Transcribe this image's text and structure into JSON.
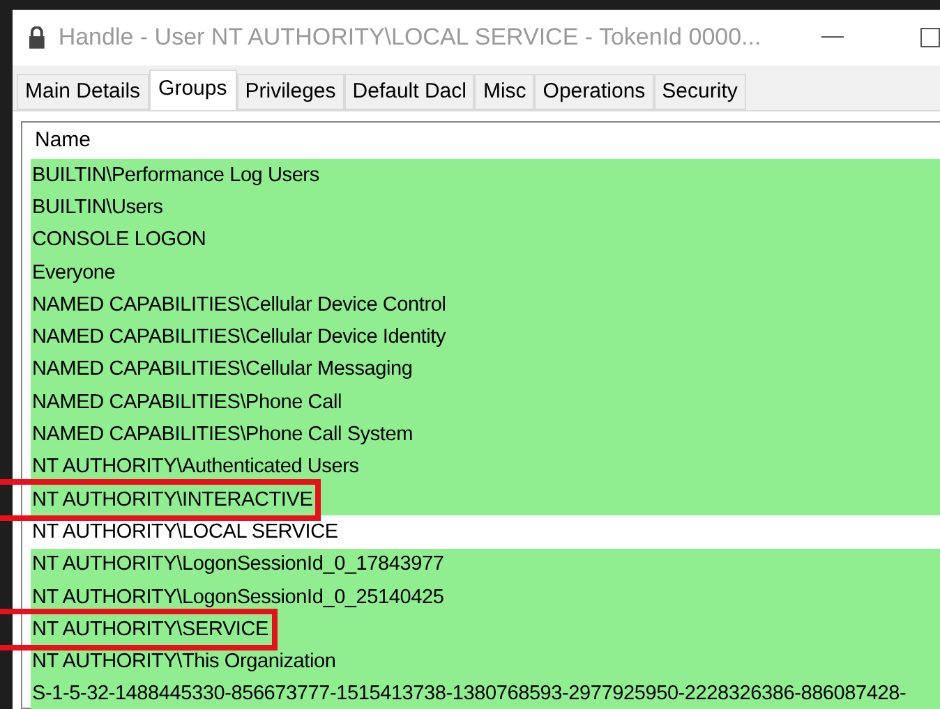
{
  "window": {
    "title": "Handle - User NT AUTHORITY\\LOCAL SERVICE - TokenId 0000..."
  },
  "tabs": [
    {
      "label": "Main Details",
      "selected": false
    },
    {
      "label": "Groups",
      "selected": true
    },
    {
      "label": "Privileges",
      "selected": false
    },
    {
      "label": "Default Dacl",
      "selected": false
    },
    {
      "label": "Misc",
      "selected": false
    },
    {
      "label": "Operations",
      "selected": false
    },
    {
      "label": "Security",
      "selected": false
    }
  ],
  "table": {
    "columns": [
      "Name"
    ],
    "rows": [
      {
        "name": "BUILTIN\\Performance Log Users",
        "color": "#90ee90",
        "marked": false
      },
      {
        "name": "BUILTIN\\Users",
        "color": "#90ee90",
        "marked": false
      },
      {
        "name": "CONSOLE LOGON",
        "color": "#90ee90",
        "marked": false
      },
      {
        "name": "Everyone",
        "color": "#90ee90",
        "marked": false
      },
      {
        "name": "NAMED CAPABILITIES\\Cellular Device Control",
        "color": "#90ee90",
        "marked": false
      },
      {
        "name": "NAMED CAPABILITIES\\Cellular Device Identity",
        "color": "#90ee90",
        "marked": false
      },
      {
        "name": "NAMED CAPABILITIES\\Cellular Messaging",
        "color": "#90ee90",
        "marked": false
      },
      {
        "name": "NAMED CAPABILITIES\\Phone Call",
        "color": "#90ee90",
        "marked": false
      },
      {
        "name": "NAMED CAPABILITIES\\Phone Call System",
        "color": "#90ee90",
        "marked": false
      },
      {
        "name": "NT AUTHORITY\\Authenticated Users",
        "color": "#90ee90",
        "marked": false
      },
      {
        "name": "NT AUTHORITY\\INTERACTIVE",
        "color": "#90ee90",
        "marked": true
      },
      {
        "name": "NT AUTHORITY\\LOCAL SERVICE",
        "color": "#ffffff",
        "marked": false
      },
      {
        "name": "NT AUTHORITY\\LogonSessionId_0_17843977",
        "color": "#90ee90",
        "marked": false
      },
      {
        "name": "NT AUTHORITY\\LogonSessionId_0_25140425",
        "color": "#90ee90",
        "marked": false
      },
      {
        "name": "NT AUTHORITY\\SERVICE",
        "color": "#90ee90",
        "marked": true
      },
      {
        "name": "NT AUTHORITY\\This Organization",
        "color": "#90ee90",
        "marked": false
      },
      {
        "name": "S-1-5-32-1488445330-856673777-1515413738-1380768593-2977925950-2228326386-886087428-",
        "color": "#90ee90",
        "marked": false
      }
    ]
  }
}
